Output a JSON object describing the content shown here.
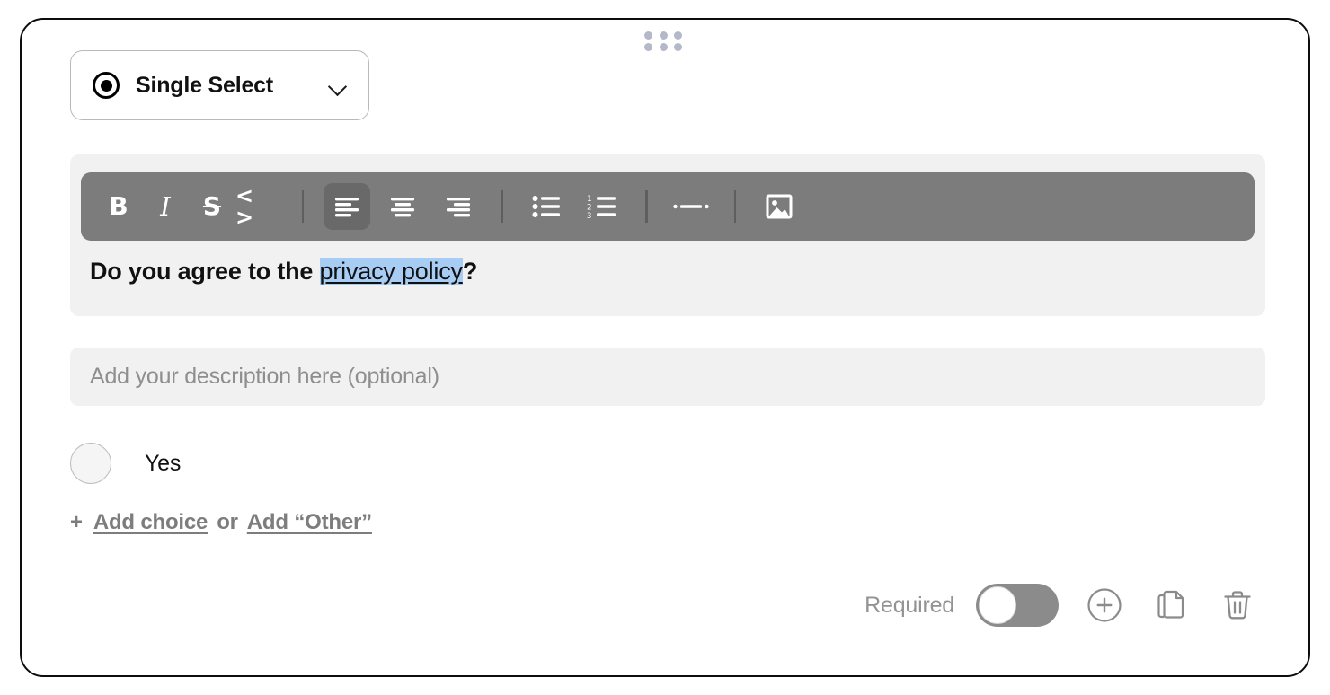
{
  "card": {
    "drag_handle": "drag-handle-dots"
  },
  "type_selector": {
    "label": "Single Select",
    "icon": "radio-filled-icon",
    "chevron": "chevron-down-icon"
  },
  "editor": {
    "toolbar": [
      {
        "name": "bold",
        "glyph": "B",
        "label": "Bold",
        "active": false
      },
      {
        "name": "italic",
        "glyph": "I",
        "label": "Italic",
        "active": false
      },
      {
        "name": "strikethrough",
        "glyph": "S",
        "label": "Strikethrough",
        "active": false
      },
      {
        "name": "code",
        "glyph": "< >",
        "label": "Code",
        "active": false
      },
      {
        "name": "align-left",
        "glyph": "",
        "label": "Align left",
        "active": true
      },
      {
        "name": "align-center",
        "glyph": "",
        "label": "Align center",
        "active": false
      },
      {
        "name": "align-right",
        "glyph": "",
        "label": "Align right",
        "active": false
      },
      {
        "name": "bullet-list",
        "glyph": "",
        "label": "Bulleted list",
        "active": false
      },
      {
        "name": "numbered-list",
        "glyph": "",
        "label": "Numbered list",
        "active": false
      },
      {
        "name": "horizontal-rule",
        "glyph": "",
        "label": "Horizontal rule",
        "active": false
      },
      {
        "name": "image",
        "glyph": "",
        "label": "Insert image",
        "active": false
      }
    ],
    "question": {
      "prefix": "Do you agree to the ",
      "link_text": "privacy policy",
      "suffix": "?",
      "selection_color": "#a8cdf5"
    }
  },
  "description": {
    "value": "",
    "placeholder": "Add your description here (optional)"
  },
  "choices": [
    {
      "label": "Yes",
      "selected": false
    }
  ],
  "add_row": {
    "plus": "+",
    "add_choice": "Add choice",
    "or": "or",
    "add_other": "Add “Other”"
  },
  "footer": {
    "required_label": "Required",
    "required_on": false,
    "icons": [
      {
        "name": "add-question-icon",
        "label": "Add question"
      },
      {
        "name": "duplicate-icon",
        "label": "Duplicate question"
      },
      {
        "name": "trash-icon",
        "label": "Delete question"
      }
    ]
  },
  "colors": {
    "card_border": "#0d0d0d",
    "toolbar_bg": "#7c7c7c",
    "toolbar_active": "#696969",
    "field_bg": "#f1f1f1",
    "muted_text": "#8b8b8b",
    "handle_dot": "#b3b9c9"
  }
}
